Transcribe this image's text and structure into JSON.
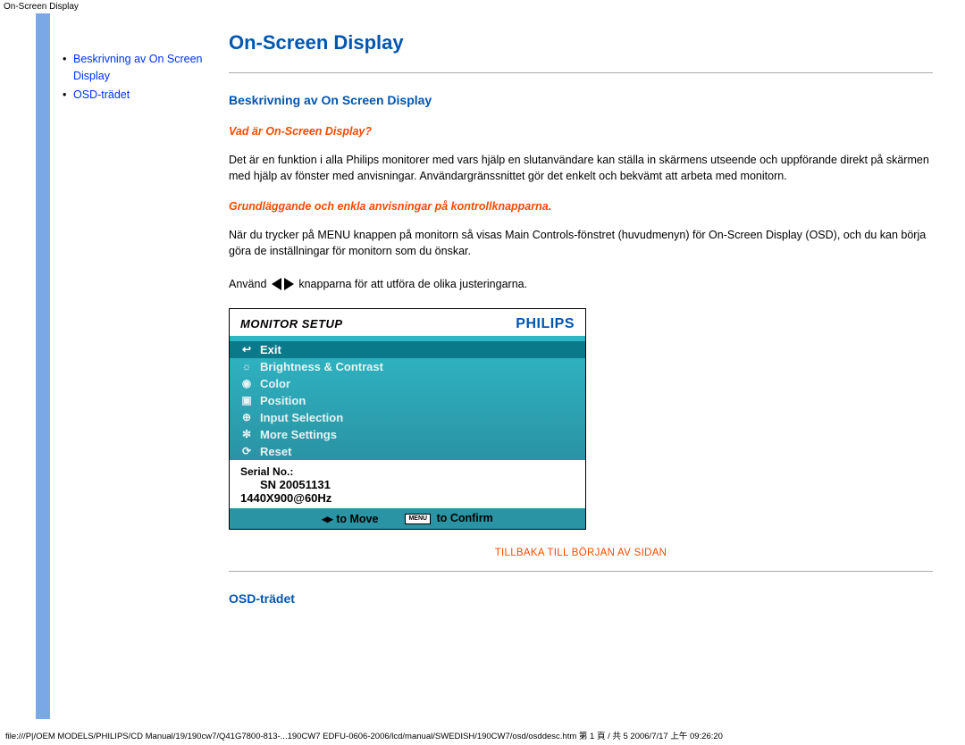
{
  "header_title": "On-Screen Display",
  "sidebar": {
    "items": [
      {
        "label": "Beskrivning av On Screen Display"
      },
      {
        "label": "OSD-trädet"
      }
    ]
  },
  "main": {
    "title": "On-Screen Display",
    "section1_title": "Beskrivning av On Screen Display",
    "sub1_title": "Vad är On-Screen Display?",
    "para1": "Det är en funktion i alla Philips monitorer med vars hjälp en slutanvändare kan ställa in skärmens utseende och uppförande direkt på skärmen med hjälp av fönster med anvisningar. Användargränssnittet gör det enkelt och bekvämt att arbeta med monitorn.",
    "sub2_title": "Grundläggande och enkla anvisningar på kontrollknapparna.",
    "para2": "När du trycker på MENU knappen på monitorn så visas Main Controls-fönstret (huvudmenyn) för On-Screen Display (OSD), och du kan börja göra de inställningar för monitorn som du önskar.",
    "para3_pre": "Använd ",
    "para3_post": " knapparna för att utföra de olika justeringarna.",
    "back_to_top": "TILLBAKA TILL BÖRJAN AV SIDAN",
    "section2_title": "OSD-trädet"
  },
  "osd": {
    "panel_title": "MONITOR SETUP",
    "brand": "PHILIPS",
    "items": [
      {
        "icon": "↩",
        "label": "Exit",
        "selected": true
      },
      {
        "icon": "☼",
        "label": "Brightness & Contrast",
        "selected": false
      },
      {
        "icon": "◉",
        "label": "Color",
        "selected": false
      },
      {
        "icon": "▣",
        "label": "Position",
        "selected": false
      },
      {
        "icon": "⊕",
        "label": "Input Selection",
        "selected": false
      },
      {
        "icon": "✼",
        "label": "More Settings",
        "selected": false
      },
      {
        "icon": "⟳",
        "label": "Reset",
        "selected": false
      }
    ],
    "serial_label": "Serial No.:",
    "serial_value": "SN 20051131",
    "resolution": "1440X900@60Hz",
    "footer_move": "◂▸ to Move",
    "footer_confirm_btn": "MENU",
    "footer_confirm": "to Confirm"
  },
  "footer_path": "file:///P|/OEM MODELS/PHILIPS/CD Manual/19/190cw7/Q41G7800-813-...190CW7 EDFU-0606-2006/lcd/manual/SWEDISH/190CW7/osd/osddesc.htm 第 1 頁 / 共 5 2006/7/17 上午 09:26:20"
}
